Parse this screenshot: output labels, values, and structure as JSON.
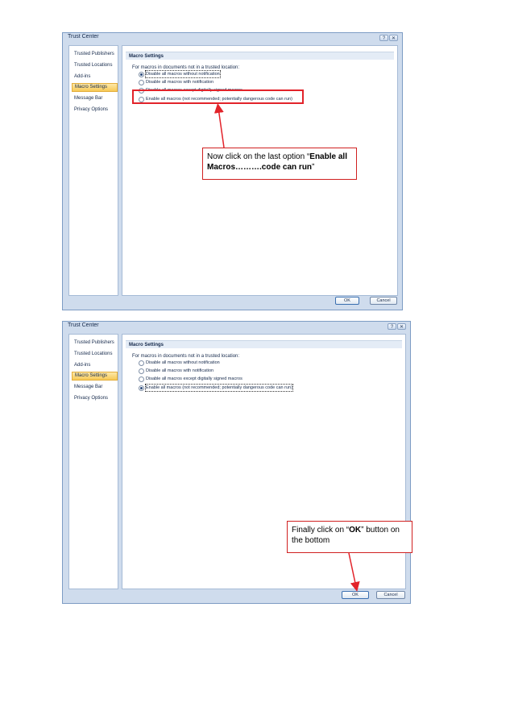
{
  "dialog1": {
    "title": "Trust Center",
    "nav": [
      "Trusted Publishers",
      "Trusted Locations",
      "Add-ins",
      "Macro Settings",
      "Message Bar",
      "Privacy Options"
    ],
    "selected_nav": 3,
    "section_header": "Macro Settings",
    "intro": "For macros in documents not in a trusted location:",
    "options": [
      "Disable all macros without notification",
      "Disable all macros with notification",
      "Disable all macros except digitally signed macros",
      "Enable all macros (not recommended; potentially dangerous code can run)"
    ],
    "selected_option": 0,
    "ok_label": "OK",
    "cancel_label": "Cancel"
  },
  "dialog2": {
    "title": "Trust Center",
    "nav": [
      "Trusted Publishers",
      "Trusted Locations",
      "Add-ins",
      "Macro Settings",
      "Message Bar",
      "Privacy Options"
    ],
    "selected_nav": 3,
    "section_header": "Macro Settings",
    "intro": "For macros in documents not in a trusted location:",
    "options": [
      "Disable all macros without notification",
      "Disable all macros with notification",
      "Disable all macros except digitally signed macros",
      "Enable all macros (not recommended; potentially dangerous code can run)"
    ],
    "selected_option": 3,
    "ok_label": "OK",
    "cancel_label": "Cancel"
  },
  "callout1": {
    "prefix": "Now click on the last option “",
    "bold": "Enable all Macros……….code can run",
    "suffix": "”"
  },
  "callout2": {
    "prefix": "Finally click on “",
    "bold": "OK",
    "suffix": "” button on the bottom"
  },
  "colors": {
    "accent_red": "#e2232a",
    "selection": "#f7c956",
    "frame": "#cfdced"
  }
}
